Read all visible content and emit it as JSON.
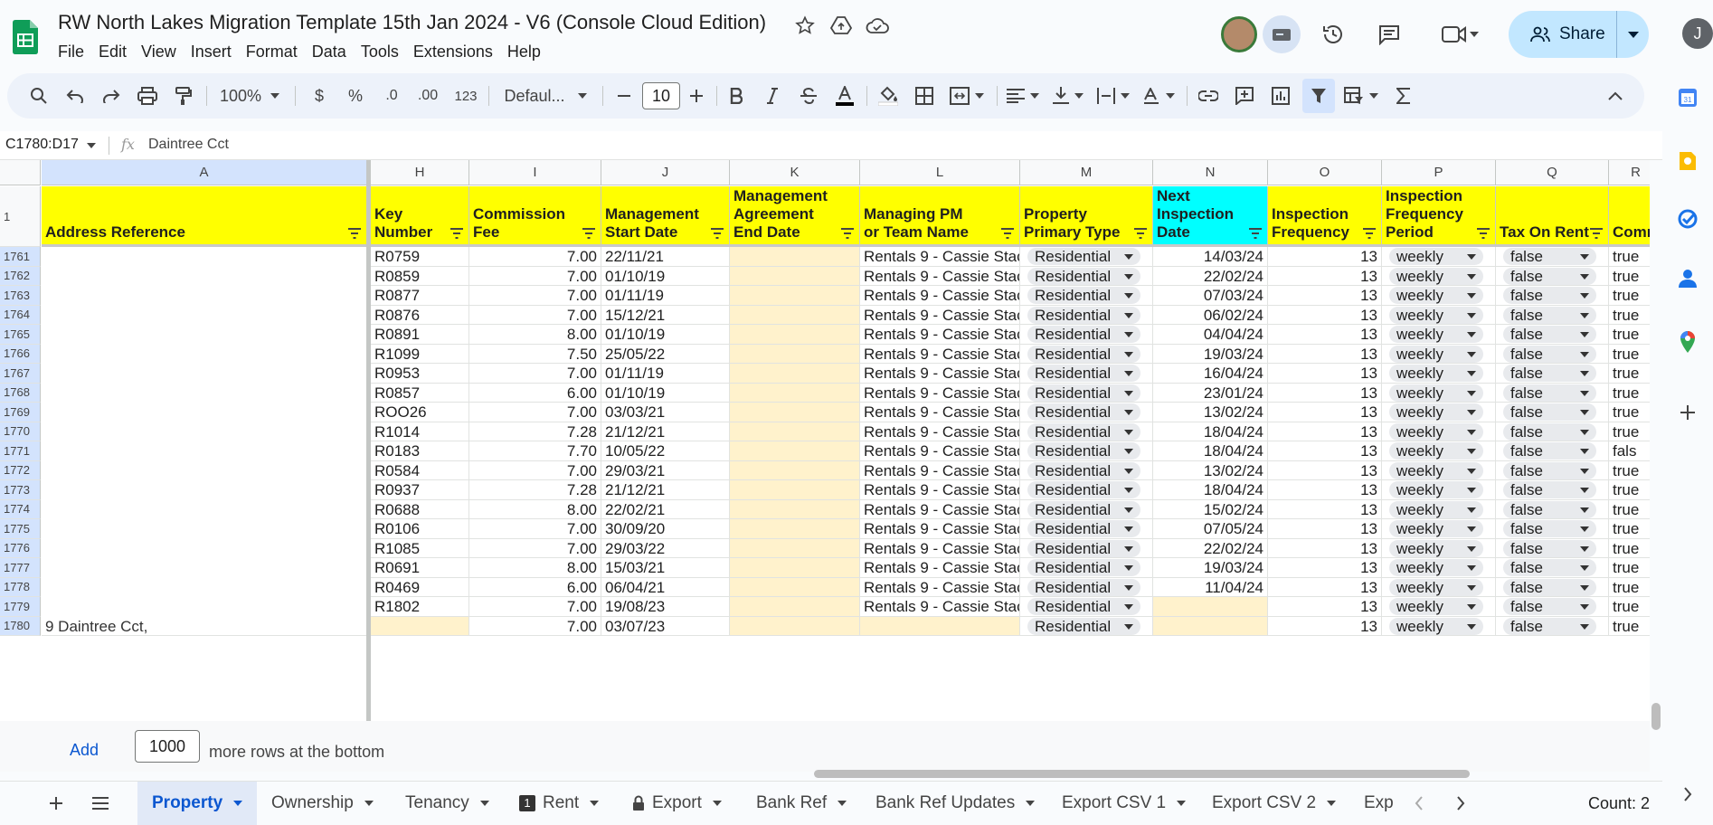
{
  "title": "RW North Lakes Migration Template 15th Jan 2024 - V6 (Console Cloud Edition)",
  "menu": [
    "File",
    "Edit",
    "View",
    "Insert",
    "Format",
    "Data",
    "Tools",
    "Extensions",
    "Help"
  ],
  "share_label": "Share",
  "account_initial": "J",
  "toolbar": {
    "zoom": "100%",
    "currency": "$",
    "percent": "%",
    "dec_less": ".0",
    "dec_more": ".00",
    "number_format": "123",
    "font": "Defaul...",
    "font_size": "10"
  },
  "namebox": "C1780:D17",
  "fx": "fx",
  "formula_value": "Daintree Cct",
  "columns": [
    {
      "letter": "A",
      "header": [
        "Address Reference"
      ]
    },
    {
      "letter": "H",
      "header": [
        "Key",
        "Number"
      ]
    },
    {
      "letter": "I",
      "header": [
        "Commission",
        "Fee"
      ]
    },
    {
      "letter": "J",
      "header": [
        "Management",
        "Start Date"
      ]
    },
    {
      "letter": "K",
      "header": [
        "Management",
        "Agreement",
        "End Date"
      ]
    },
    {
      "letter": "L",
      "header": [
        "Managing PM",
        "or Team Name"
      ]
    },
    {
      "letter": "M",
      "header": [
        "Property",
        "Primary Type"
      ]
    },
    {
      "letter": "N",
      "header": [
        "Next",
        "Inspection",
        "Date"
      ]
    },
    {
      "letter": "O",
      "header": [
        "Inspection",
        "Frequency"
      ]
    },
    {
      "letter": "P",
      "header": [
        "Inspection",
        "Frequency",
        "Period"
      ]
    },
    {
      "letter": "Q",
      "header": [
        "Tax On Rent"
      ]
    },
    {
      "letter": "R",
      "header": [
        "Comm"
      ]
    }
  ],
  "header_row_number": "1",
  "rows": [
    {
      "n": "1761",
      "key": "R0759",
      "fee": "7.00",
      "start": "22/11/21",
      "pm": "Rentals 9 - Cassie Stac",
      "type": "Residential",
      "next": "14/03/24",
      "freq": "13",
      "period": "weekly",
      "tax": "false",
      "comm": "true"
    },
    {
      "n": "1762",
      "key": "R0859",
      "fee": "7.00",
      "start": "01/10/19",
      "pm": "Rentals 9 - Cassie Stac",
      "type": "Residential",
      "next": "22/02/24",
      "freq": "13",
      "period": "weekly",
      "tax": "false",
      "comm": "true"
    },
    {
      "n": "1763",
      "key": "R0877",
      "fee": "7.00",
      "start": "01/11/19",
      "pm": "Rentals 9 - Cassie Stac",
      "type": "Residential",
      "next": "07/03/24",
      "freq": "13",
      "period": "weekly",
      "tax": "false",
      "comm": "true"
    },
    {
      "n": "1764",
      "key": "R0876",
      "fee": "7.00",
      "start": "15/12/21",
      "pm": "Rentals 9 - Cassie Stac",
      "type": "Residential",
      "next": "06/02/24",
      "freq": "13",
      "period": "weekly",
      "tax": "false",
      "comm": "true"
    },
    {
      "n": "1765",
      "key": "R0891",
      "fee": "8.00",
      "start": "01/10/19",
      "pm": "Rentals 9 - Cassie Stac",
      "type": "Residential",
      "next": "04/04/24",
      "freq": "13",
      "period": "weekly",
      "tax": "false",
      "comm": "true"
    },
    {
      "n": "1766",
      "key": "R1099",
      "fee": "7.50",
      "start": "25/05/22",
      "pm": "Rentals 9 - Cassie Stac",
      "type": "Residential",
      "next": "19/03/24",
      "freq": "13",
      "period": "weekly",
      "tax": "false",
      "comm": "true"
    },
    {
      "n": "1767",
      "key": "R0953",
      "fee": "7.00",
      "start": "01/11/19",
      "pm": "Rentals 9 - Cassie Stac",
      "type": "Residential",
      "next": "16/04/24",
      "freq": "13",
      "period": "weekly",
      "tax": "false",
      "comm": "true"
    },
    {
      "n": "1768",
      "key": "R0857",
      "fee": "6.00",
      "start": "01/10/19",
      "pm": "Rentals 9 - Cassie Stac",
      "type": "Residential",
      "next": "23/01/24",
      "freq": "13",
      "period": "weekly",
      "tax": "false",
      "comm": "true"
    },
    {
      "n": "1769",
      "key": "ROO26",
      "fee": "7.00",
      "start": "03/03/21",
      "pm": "Rentals 9 - Cassie Stac",
      "type": "Residential",
      "next": "13/02/24",
      "freq": "13",
      "period": "weekly",
      "tax": "false",
      "comm": "true"
    },
    {
      "n": "1770",
      "key": "R1014",
      "fee": "7.28",
      "start": "21/12/21",
      "pm": "Rentals 9 - Cassie Stac",
      "type": "Residential",
      "next": "18/04/24",
      "freq": "13",
      "period": "weekly",
      "tax": "false",
      "comm": "true"
    },
    {
      "n": "1771",
      "key": "R0183",
      "fee": "7.70",
      "start": "10/05/22",
      "pm": "Rentals 9 - Cassie Stac",
      "type": "Residential",
      "next": "18/04/24",
      "freq": "13",
      "period": "weekly",
      "tax": "false",
      "comm": "fals"
    },
    {
      "n": "1772",
      "key": "R0584",
      "fee": "7.00",
      "start": "29/03/21",
      "pm": "Rentals 9 - Cassie Stac",
      "type": "Residential",
      "next": "13/02/24",
      "freq": "13",
      "period": "weekly",
      "tax": "false",
      "comm": "true"
    },
    {
      "n": "1773",
      "key": "R0937",
      "fee": "7.28",
      "start": "21/12/21",
      "pm": "Rentals 9 - Cassie Stac",
      "type": "Residential",
      "next": "18/04/24",
      "freq": "13",
      "period": "weekly",
      "tax": "false",
      "comm": "true"
    },
    {
      "n": "1774",
      "key": "R0688",
      "fee": "8.00",
      "start": "22/02/21",
      "pm": "Rentals 9 - Cassie Stac",
      "type": "Residential",
      "next": "15/02/24",
      "freq": "13",
      "period": "weekly",
      "tax": "false",
      "comm": "true"
    },
    {
      "n": "1775",
      "key": "R0106",
      "fee": "7.00",
      "start": "30/09/20",
      "pm": "Rentals 9 - Cassie Stac",
      "type": "Residential",
      "next": "07/05/24",
      "freq": "13",
      "period": "weekly",
      "tax": "false",
      "comm": "true"
    },
    {
      "n": "1776",
      "key": "R1085",
      "fee": "7.00",
      "start": "29/03/22",
      "pm": "Rentals 9 - Cassie Stac",
      "type": "Residential",
      "next": "22/02/24",
      "freq": "13",
      "period": "weekly",
      "tax": "false",
      "comm": "true"
    },
    {
      "n": "1777",
      "key": "R0691",
      "fee": "8.00",
      "start": "15/03/21",
      "pm": "Rentals 9 - Cassie Stac",
      "type": "Residential",
      "next": "19/03/24",
      "freq": "13",
      "period": "weekly",
      "tax": "false",
      "comm": "true"
    },
    {
      "n": "1778",
      "key": "R0469",
      "fee": "6.00",
      "start": "06/04/21",
      "pm": "Rentals 9 - Cassie Stac",
      "type": "Residential",
      "next": "11/04/24",
      "freq": "13",
      "period": "weekly",
      "tax": "false",
      "comm": "true"
    },
    {
      "n": "1779",
      "key": "R1802",
      "fee": "7.00",
      "start": "19/08/23",
      "pm": "Rentals 9 - Cassie Stac",
      "type": "Residential",
      "next": "",
      "freq": "13",
      "period": "weekly",
      "tax": "false",
      "comm": "true"
    },
    {
      "n": "1780",
      "key": "",
      "fee": "7.00",
      "start": "03/07/23",
      "pm": "",
      "type": "Residential",
      "next": "",
      "freq": "13",
      "period": "weekly",
      "tax": "false",
      "comm": "true"
    }
  ],
  "row_1780_address_fragment": "9 Daintree Cct,",
  "add_rows": {
    "button": "Add",
    "value": "1000",
    "suffix": "more rows at the bottom"
  },
  "tabs": [
    "Property",
    "Ownership",
    "Tenancy",
    "Rent",
    "Export",
    "Bank Ref",
    "Bank Ref Updates",
    "Export CSV 1",
    "Export CSV 2",
    "Exp"
  ],
  "rent_tab_badge": "1",
  "status": "Count: 2",
  "colors": {
    "header_yellow": "#ffff00",
    "header_cyan": "#00ffff",
    "empty_required": "#fff2cc",
    "accent": "#0b57d0"
  }
}
